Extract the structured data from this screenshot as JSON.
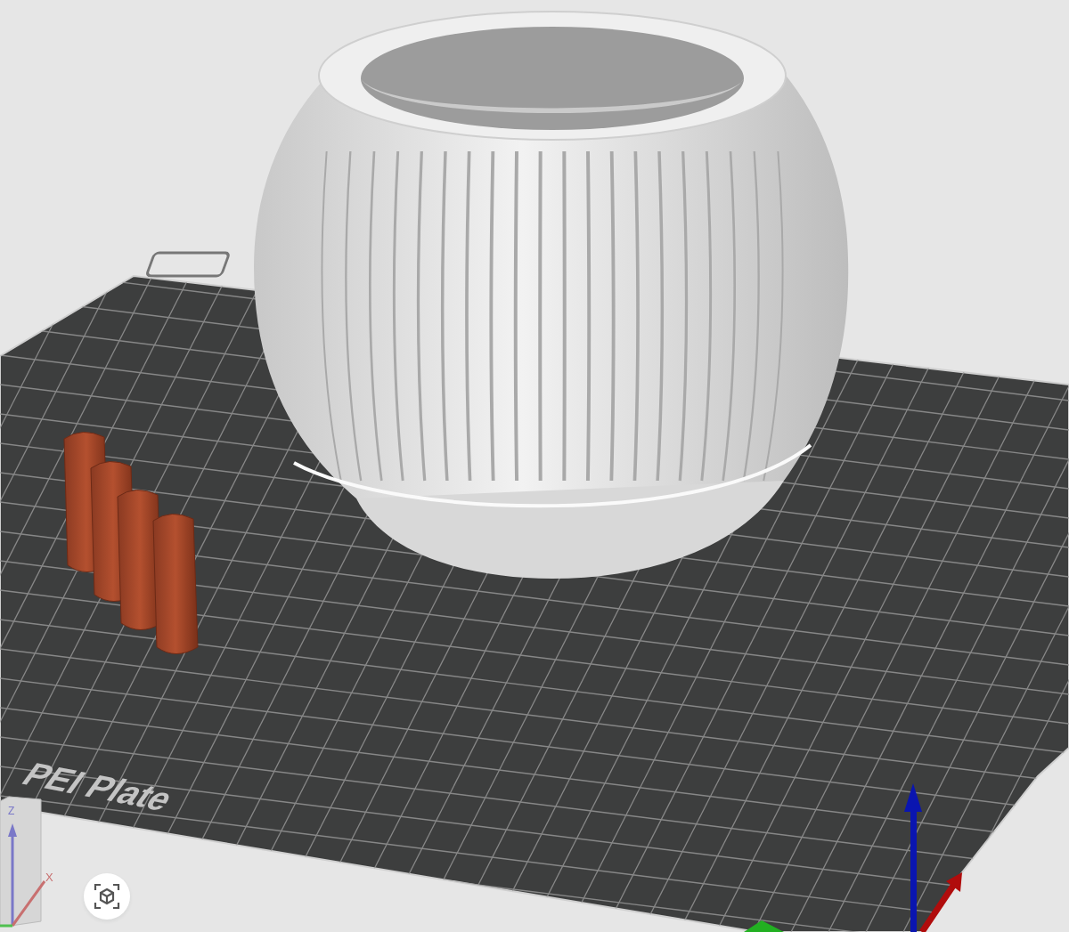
{
  "viewport": {
    "plate_label": "PEI Plate",
    "view_cube": {
      "z_label": "Z",
      "x_label": "X"
    }
  }
}
